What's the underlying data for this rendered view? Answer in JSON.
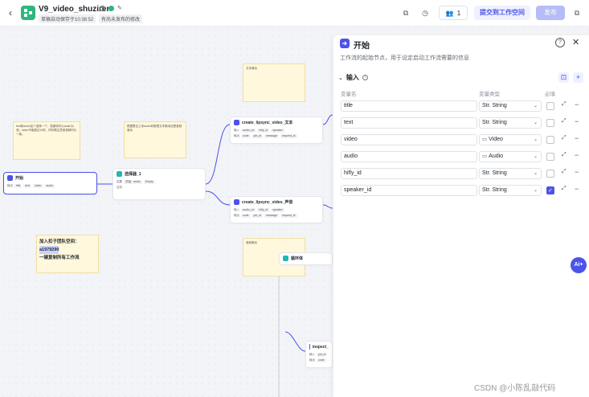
{
  "header": {
    "back": "‹",
    "title": "V9_video_shuziren",
    "autosave": "草稿自动保存于10:38:52",
    "unpublished": "有尚未发布的修改",
    "user_count": "1",
    "submit_label": "提交到工作空间",
    "publish_label": "发布"
  },
  "canvas": {
    "notes": [
      "text和audio至少选择一个，若都填写以audio为准；video不能超过10秒，同时需注意音视频时长一致。",
      "根据是否上传audio判断是文本驱动还是音频驱动",
      "文本驱动",
      "音频驱动"
    ],
    "promo_note": {
      "line1": "加入扣子团队空间：",
      "line2": "a1979290",
      "line3": "一键复制所有工作流"
    },
    "nodes": {
      "start": {
        "title": "开始",
        "out_label": "输出",
        "tags": [
          "title",
          "text",
          "video",
          "audio"
        ]
      },
      "selector": {
        "title": "选择器_1",
        "if_label": "如果",
        "cond_field": "开始 · audio",
        "cond_op": "Empty",
        "else_label": "否则"
      },
      "text_node": {
        "title": "create_lipsync_video_文本",
        "in_label": "输入",
        "out_label": "输出",
        "in_tags": [
          "audio_url",
          "hifly_id",
          "speaker"
        ],
        "out_tags": [
          "code",
          "job_id",
          "message",
          "request_id"
        ]
      },
      "audio_node": {
        "title": "create_lipsync_video_声音",
        "in_label": "输入",
        "out_label": "输出",
        "in_tags": [
          "audio_url",
          "hifly_id",
          "speaker"
        ],
        "out_tags": [
          "code",
          "job_id",
          "message",
          "request_id"
        ]
      },
      "loop": {
        "title": "循环体"
      },
      "inspect": {
        "title": "inspect_",
        "in_label": "输入",
        "out_label": "输出",
        "in_tags": [
          "job_id"
        ],
        "out_tags": [
          "code"
        ]
      }
    },
    "ai_button": "Ai+",
    "watermark": "CSDN @小陈乱敲代码"
  },
  "panel": {
    "title": "开始",
    "description": "工作流的起始节点，用于设定启动工作流需要的信息",
    "section_title": "输入",
    "col_name": "变量名",
    "col_type": "变量类型",
    "col_required": "必填",
    "variables": [
      {
        "name": "title",
        "type": "Str. String",
        "glyph": "Str.",
        "required": false
      },
      {
        "name": "text",
        "type": "Str. String",
        "glyph": "Str.",
        "required": false
      },
      {
        "name": "video",
        "type": "Video",
        "glyph": "▭",
        "required": false
      },
      {
        "name": "audio",
        "type": "Audio",
        "glyph": "▭",
        "required": false
      },
      {
        "name": "hifly_id",
        "type": "Str. String",
        "glyph": "Str.",
        "required": false
      },
      {
        "name": "speaker_id",
        "type": "Str. String",
        "glyph": "Str.",
        "required": true
      }
    ]
  },
  "colors": {
    "accent": "#4d53e8",
    "brand_green": "#2eb67d",
    "note_bg": "#fff8dd"
  }
}
